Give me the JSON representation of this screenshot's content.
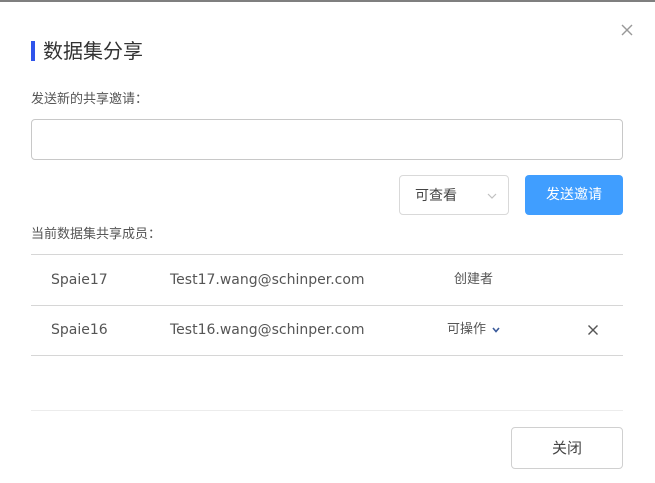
{
  "dialog": {
    "title": "数据集分享",
    "close_icon": "close-icon",
    "accent_color": "#2f54eb"
  },
  "invite": {
    "label": "发送新的共享邀请：",
    "input_value": "",
    "input_placeholder": "",
    "permission_selected": "可查看",
    "send_label": "发送邀请",
    "send_color": "#409eff"
  },
  "members": {
    "label": "当前数据集共享成员：",
    "rows": [
      {
        "name": "Spaie17",
        "email": "Test17.wang@schinper.com",
        "role": "创建者"
      },
      {
        "name": "Spaie16",
        "email": "Test16.wang@schinper.com",
        "role": "可操作"
      }
    ]
  },
  "footer": {
    "close_label": "关闭"
  }
}
